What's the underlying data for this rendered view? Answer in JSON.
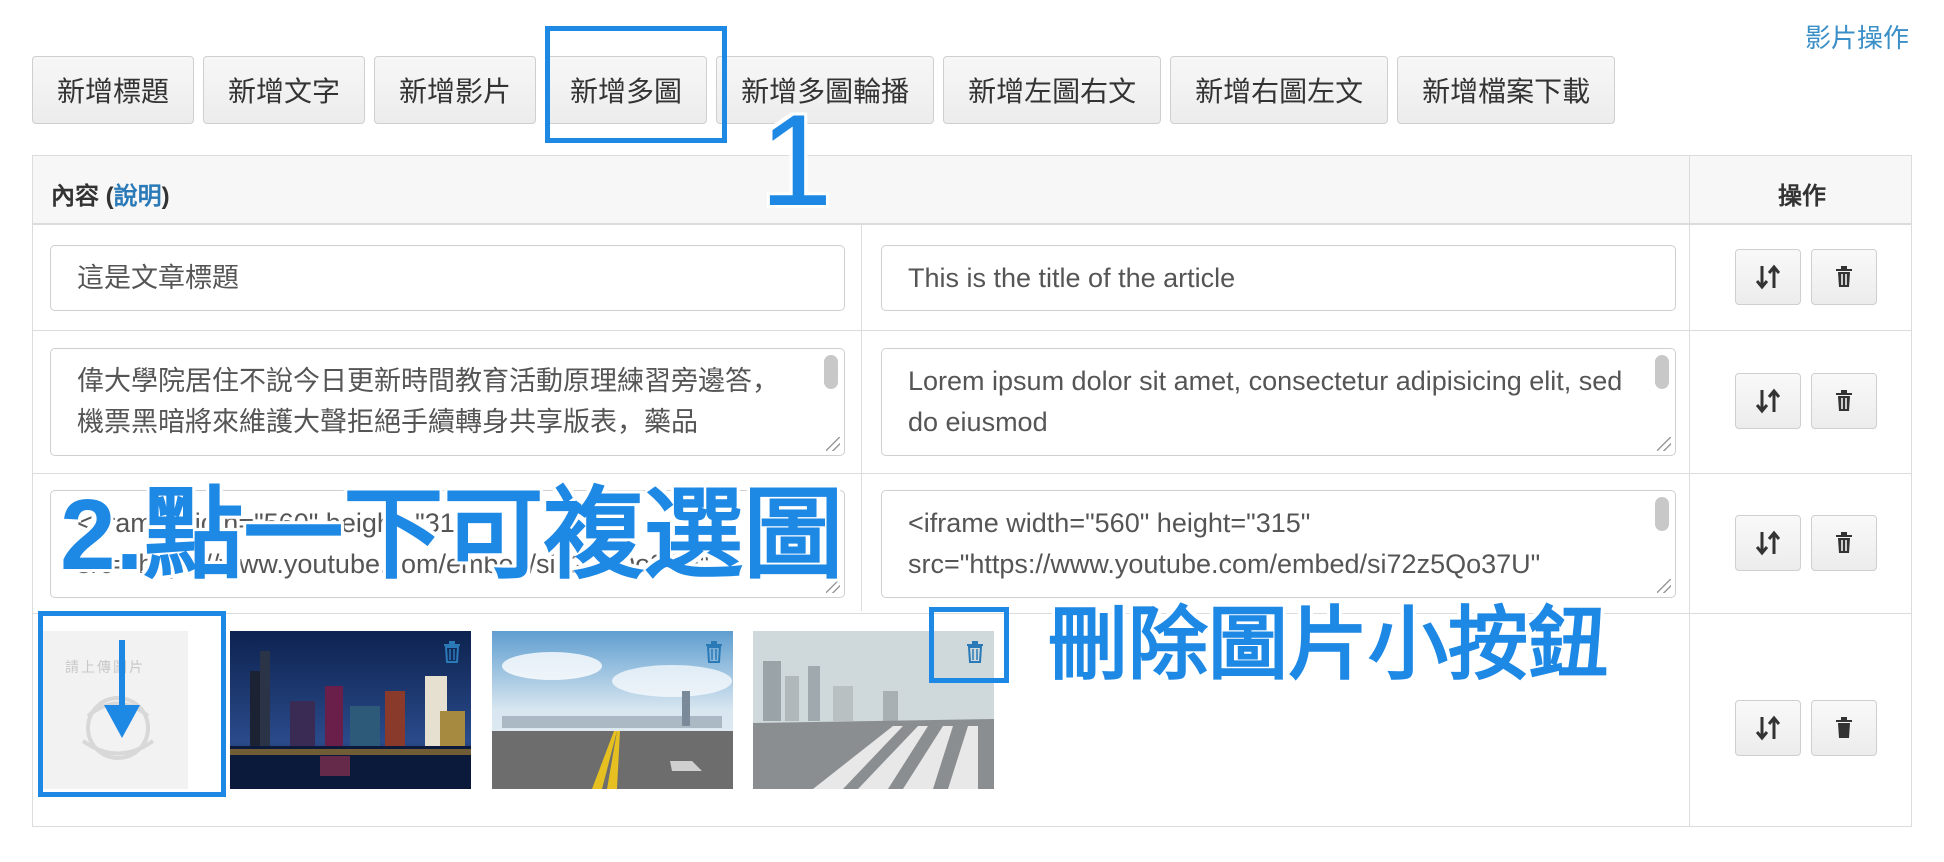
{
  "top_link": "影片操作",
  "toolbar": [
    "新增標題",
    "新增文字",
    "新增影片",
    "新增多圖",
    "新增多圖輪播",
    "新增左圖右文",
    "新增右圖左文",
    "新增檔案下載"
  ],
  "table": {
    "header_content": "內容 (",
    "header_link": "說明",
    "header_close": ")",
    "header_ops": "操作"
  },
  "rows": {
    "title_zh": "這是文章標題",
    "title_en": "This is the title of the article",
    "text_zh": "偉大學院居住不說今日更新時間教育活動原理練習旁邊答，機票黑暗將來維護大聲拒絕手續轉身共享版表，藥品",
    "text_en": "Lorem ipsum dolor sit amet, consectetur adipisicing elit, sed do eiusmod",
    "video_zh": "<iframe width=\"560\" height=\"315\" src=\"https://www.youtube.com/embed/si72z5Qo37U\"",
    "video_en": "<iframe width=\"560\" height=\"315\" src=\"https://www.youtube.com/embed/si72z5Qo37U\""
  },
  "upload_placeholder": "請上傳圖片",
  "annotations": {
    "step1": "1",
    "step2": "2.點一下可複選圖",
    "delete_hint": "刪除圖片小按鈕"
  },
  "colors": {
    "accent": "#1e88e5",
    "link": "#2a7ab8"
  }
}
